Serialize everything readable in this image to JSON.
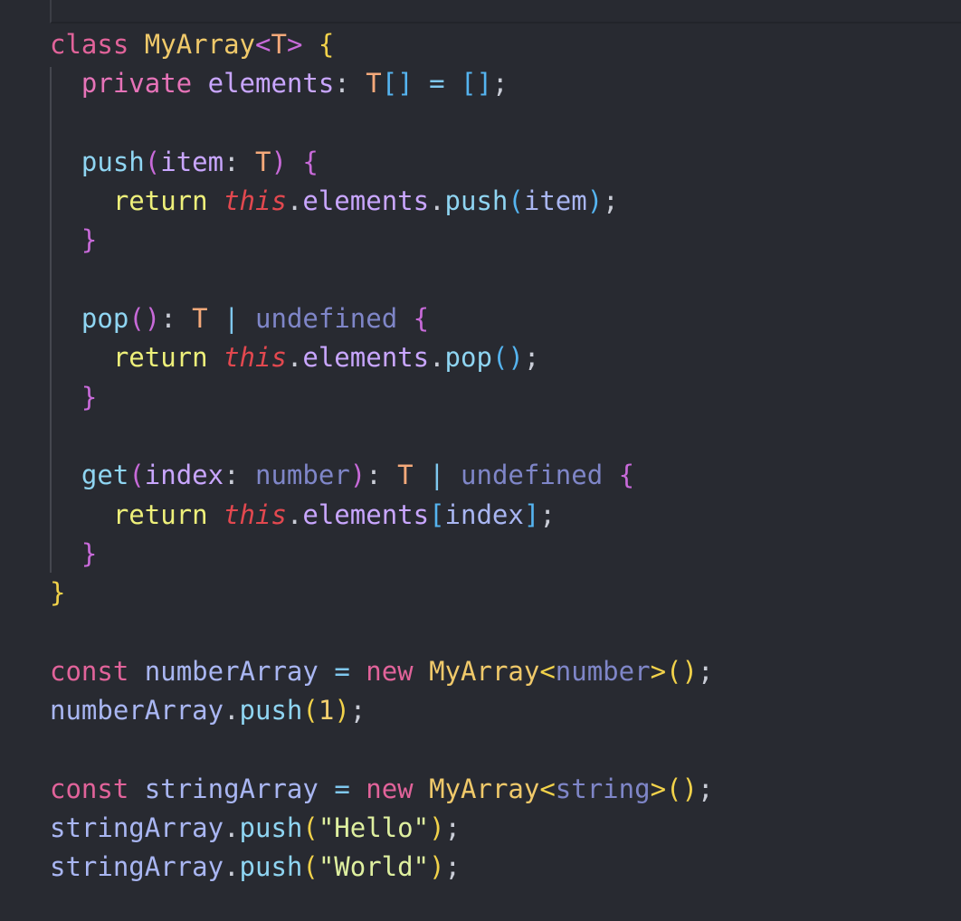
{
  "editor": {
    "language": "typescript",
    "lines": [
      [
        [
          "kw",
          "class"
        ],
        [
          "punc",
          " "
        ],
        [
          "cls",
          "MyArray"
        ],
        [
          "b2",
          "<"
        ],
        [
          "type",
          "T"
        ],
        [
          "b2",
          ">"
        ],
        [
          "punc",
          " "
        ],
        [
          "b1",
          "{"
        ]
      ],
      [
        [
          "punc",
          "  "
        ],
        [
          "mod",
          "private"
        ],
        [
          "punc",
          " "
        ],
        [
          "prop",
          "elements"
        ],
        [
          "punc",
          ": "
        ],
        [
          "type",
          "T"
        ],
        [
          "b3",
          "[]"
        ],
        [
          "punc",
          " "
        ],
        [
          "op",
          "="
        ],
        [
          "punc",
          " "
        ],
        [
          "b3",
          "[]"
        ],
        [
          "punc",
          ";"
        ]
      ],
      [],
      [
        [
          "punc",
          "  "
        ],
        [
          "fn",
          "push"
        ],
        [
          "b2",
          "("
        ],
        [
          "prop",
          "item"
        ],
        [
          "punc",
          ": "
        ],
        [
          "type",
          "T"
        ],
        [
          "b2",
          ")"
        ],
        [
          "punc",
          " "
        ],
        [
          "b2",
          "{"
        ]
      ],
      [
        [
          "punc",
          "    "
        ],
        [
          "ret",
          "return"
        ],
        [
          "punc",
          " "
        ],
        [
          "ths",
          "this"
        ],
        [
          "punc",
          "."
        ],
        [
          "prop",
          "elements"
        ],
        [
          "punc",
          "."
        ],
        [
          "fnb",
          "push"
        ],
        [
          "b3",
          "("
        ],
        [
          "var",
          "item"
        ],
        [
          "b3",
          ")"
        ],
        [
          "punc",
          ";"
        ]
      ],
      [
        [
          "punc",
          "  "
        ],
        [
          "b2",
          "}"
        ]
      ],
      [],
      [
        [
          "punc",
          "  "
        ],
        [
          "fn",
          "pop"
        ],
        [
          "b2",
          "()"
        ],
        [
          "punc",
          ": "
        ],
        [
          "type",
          "T"
        ],
        [
          "punc",
          " "
        ],
        [
          "op",
          "|"
        ],
        [
          "punc",
          " "
        ],
        [
          "prim",
          "undefined"
        ],
        [
          "punc",
          " "
        ],
        [
          "b2",
          "{"
        ]
      ],
      [
        [
          "punc",
          "    "
        ],
        [
          "ret",
          "return"
        ],
        [
          "punc",
          " "
        ],
        [
          "ths",
          "this"
        ],
        [
          "punc",
          "."
        ],
        [
          "prop",
          "elements"
        ],
        [
          "punc",
          "."
        ],
        [
          "fnb",
          "pop"
        ],
        [
          "b3",
          "()"
        ],
        [
          "punc",
          ";"
        ]
      ],
      [
        [
          "punc",
          "  "
        ],
        [
          "b2",
          "}"
        ]
      ],
      [],
      [
        [
          "punc",
          "  "
        ],
        [
          "fn",
          "get"
        ],
        [
          "b2",
          "("
        ],
        [
          "prop",
          "index"
        ],
        [
          "punc",
          ": "
        ],
        [
          "prim",
          "number"
        ],
        [
          "b2",
          ")"
        ],
        [
          "punc",
          ": "
        ],
        [
          "type",
          "T"
        ],
        [
          "punc",
          " "
        ],
        [
          "op",
          "|"
        ],
        [
          "punc",
          " "
        ],
        [
          "prim",
          "undefined"
        ],
        [
          "punc",
          " "
        ],
        [
          "b2",
          "{"
        ]
      ],
      [
        [
          "punc",
          "    "
        ],
        [
          "ret",
          "return"
        ],
        [
          "punc",
          " "
        ],
        [
          "ths",
          "this"
        ],
        [
          "punc",
          "."
        ],
        [
          "prop",
          "elements"
        ],
        [
          "b3",
          "["
        ],
        [
          "var",
          "index"
        ],
        [
          "b3",
          "]"
        ],
        [
          "punc",
          ";"
        ]
      ],
      [
        [
          "punc",
          "  "
        ],
        [
          "b2",
          "}"
        ]
      ],
      [
        [
          "b1",
          "}"
        ]
      ],
      [],
      [
        [
          "kw",
          "const"
        ],
        [
          "punc",
          " "
        ],
        [
          "var",
          "numberArray"
        ],
        [
          "punc",
          " "
        ],
        [
          "op",
          "="
        ],
        [
          "punc",
          " "
        ],
        [
          "kw",
          "new"
        ],
        [
          "punc",
          " "
        ],
        [
          "cls",
          "MyArray"
        ],
        [
          "b1",
          "<"
        ],
        [
          "prim",
          "number"
        ],
        [
          "b1",
          ">"
        ],
        [
          "b1",
          "()"
        ],
        [
          "punc",
          ";"
        ]
      ],
      [
        [
          "var",
          "numberArray"
        ],
        [
          "punc",
          "."
        ],
        [
          "fnb",
          "push"
        ],
        [
          "b1",
          "("
        ],
        [
          "num",
          "1"
        ],
        [
          "b1",
          ")"
        ],
        [
          "punc",
          ";"
        ]
      ],
      [],
      [
        [
          "kw",
          "const"
        ],
        [
          "punc",
          " "
        ],
        [
          "var",
          "stringArray"
        ],
        [
          "punc",
          " "
        ],
        [
          "op",
          "="
        ],
        [
          "punc",
          " "
        ],
        [
          "kw",
          "new"
        ],
        [
          "punc",
          " "
        ],
        [
          "cls",
          "MyArray"
        ],
        [
          "b1",
          "<"
        ],
        [
          "prim",
          "string"
        ],
        [
          "b1",
          ">"
        ],
        [
          "b1",
          "()"
        ],
        [
          "punc",
          ";"
        ]
      ],
      [
        [
          "var",
          "stringArray"
        ],
        [
          "punc",
          "."
        ],
        [
          "fnb",
          "push"
        ],
        [
          "b1",
          "("
        ],
        [
          "str",
          "\"Hello\""
        ],
        [
          "b1",
          ")"
        ],
        [
          "punc",
          ";"
        ]
      ],
      [
        [
          "var",
          "stringArray"
        ],
        [
          "punc",
          "."
        ],
        [
          "fnb",
          "push"
        ],
        [
          "b1",
          "("
        ],
        [
          "str",
          "\"World\""
        ],
        [
          "b1",
          ")"
        ],
        [
          "punc",
          ";"
        ]
      ]
    ]
  }
}
